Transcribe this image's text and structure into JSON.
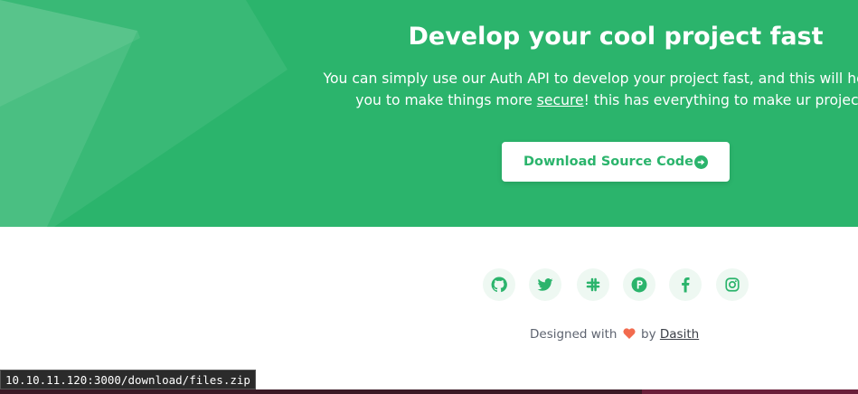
{
  "hero": {
    "title": "Develop your cool project fast",
    "line1": "You can simply use our Auth API to develop your project fast, and this will help you",
    "line2_before": "you to make things more ",
    "line2_link": "secure",
    "line2_after": "! this has everything to make ur project s",
    "download_label": "Download Source Code",
    "download_icon": "arrow-circle-right-icon",
    "accent_color": "#2bb46c"
  },
  "socials": [
    {
      "name": "github",
      "icon": "github-icon"
    },
    {
      "name": "twitter",
      "icon": "twitter-icon"
    },
    {
      "name": "slack",
      "icon": "slack-icon"
    },
    {
      "name": "producthunt",
      "icon": "producthunt-icon"
    },
    {
      "name": "facebook",
      "icon": "facebook-icon"
    },
    {
      "name": "instagram",
      "icon": "instagram-icon"
    }
  ],
  "footer": {
    "credit_before": "Designed with",
    "heart_icon": "heart-icon",
    "credit_by": "by",
    "author": "Dasith",
    "heart_color": "#f26b4e"
  },
  "status": {
    "url": "10.10.11.120:3000/download/files.zip"
  }
}
